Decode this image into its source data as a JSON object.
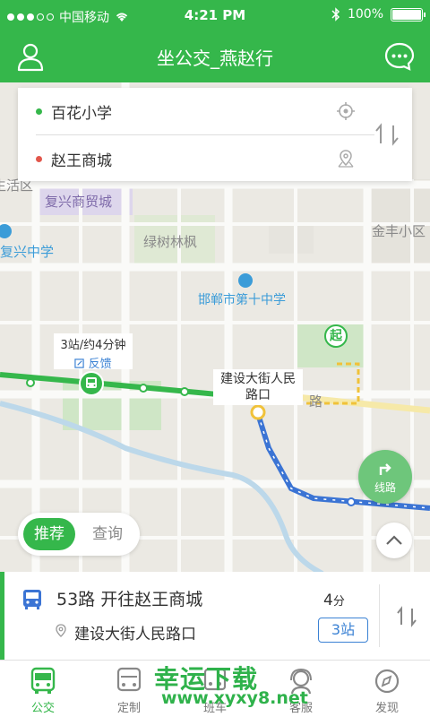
{
  "status_bar": {
    "carrier": "中国移动",
    "time": "4:21 PM",
    "battery": "100%"
  },
  "header": {
    "title": "坐公交_燕赵行"
  },
  "search": {
    "from": "百花小学",
    "to": "赵王商城",
    "from_dot_color": "#35b74b",
    "to_dot_color": "#e2574c"
  },
  "map": {
    "places": {
      "fuxing_trade": "复兴商贸城",
      "lvshu_linfeng": "绿树林枫",
      "jinfeng": "金丰小区",
      "fuxing_middle": "复兴中学",
      "handan_10th": "邯郸市第十中学",
      "shenghuo": "生活区",
      "road": "路"
    },
    "bus_callout": {
      "info": "3站/约4分钟",
      "feedback": "反馈"
    },
    "stop_label": "建设大街人民\n路口",
    "start_marker": "起",
    "route_button": "线路",
    "colors": {
      "walk_route": "#35b74b",
      "bus_route": "#3b74d4",
      "walk_dashed": "#f0c23a"
    }
  },
  "toggle": {
    "recommend": "推荐",
    "query": "查询"
  },
  "result": {
    "route": "53路 开往赵王商城",
    "stop": "建设大街人民路口",
    "minutes": "4",
    "minutes_unit": "分",
    "stations": "3站"
  },
  "tabbar": {
    "items": [
      {
        "label": "公交",
        "icon": "bus-icon",
        "active": true
      },
      {
        "label": "定制",
        "icon": "custom-bus-icon",
        "active": false
      },
      {
        "label": "班车",
        "icon": "shuttle-icon",
        "active": false
      },
      {
        "label": "客服",
        "icon": "service-icon",
        "active": false
      },
      {
        "label": "发现",
        "icon": "compass-icon",
        "active": false
      }
    ]
  },
  "watermark": {
    "line1": "幸运下载",
    "line2": "www.xyxy8.net"
  }
}
